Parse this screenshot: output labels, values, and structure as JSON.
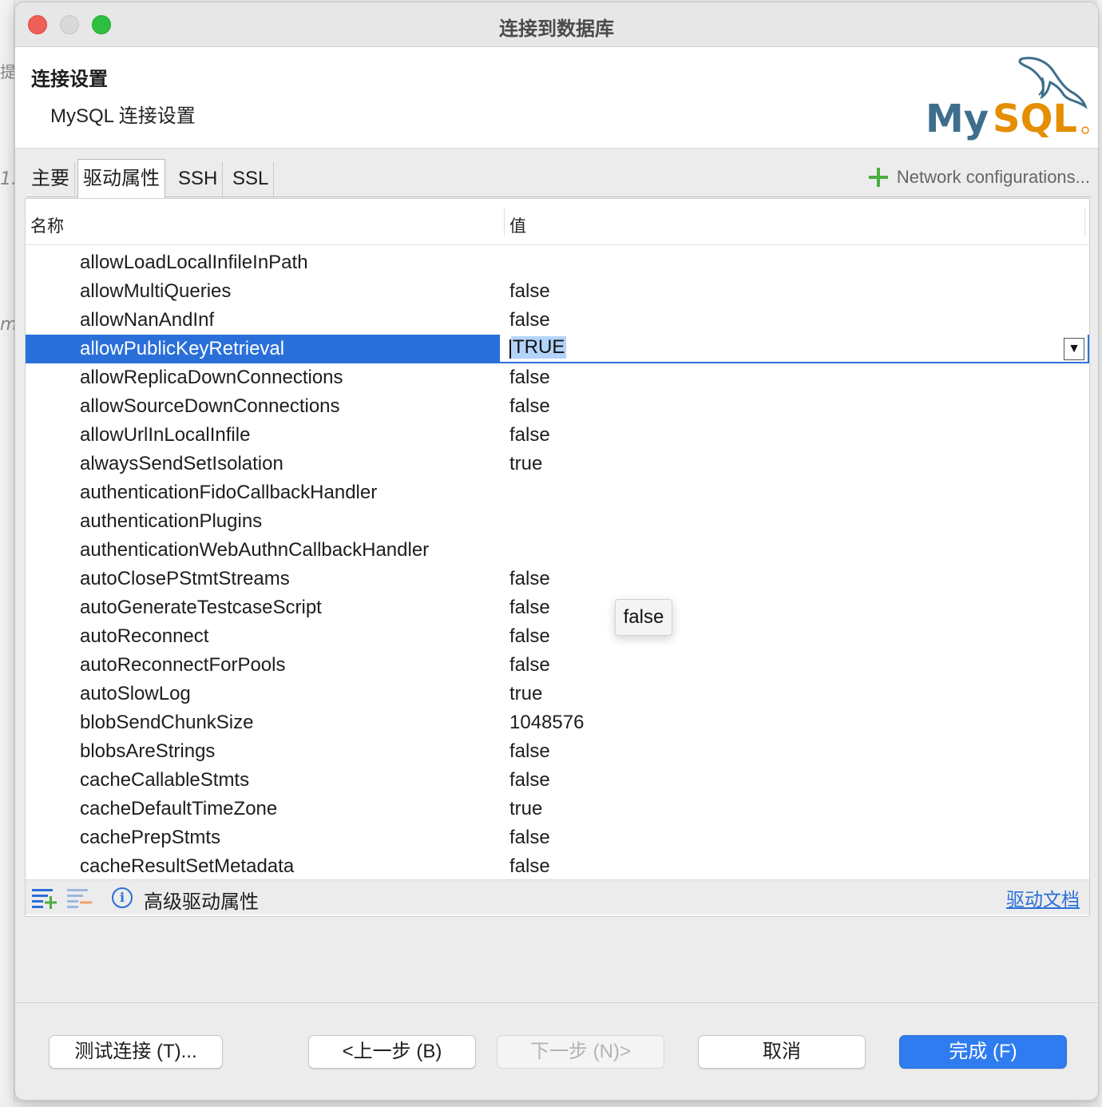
{
  "window": {
    "title": "连接到数据库"
  },
  "header": {
    "title": "连接设置",
    "subtitle": "MySQL 连接设置",
    "logo_text": "MySQL"
  },
  "tabs": [
    {
      "label": "主要",
      "active": false
    },
    {
      "label": "驱动属性",
      "active": true
    },
    {
      "label": "SSH",
      "active": false
    },
    {
      "label": "SSL",
      "active": false
    }
  ],
  "network_config": {
    "label": "Network configurations...",
    "icon": "plus-icon",
    "color": "#4bae3f"
  },
  "table": {
    "columns": [
      "名称",
      "值"
    ],
    "rows": [
      {
        "name": "allowLoadLocalInfileInPath",
        "value": ""
      },
      {
        "name": "allowMultiQueries",
        "value": "false"
      },
      {
        "name": "allowNanAndInf",
        "value": "false"
      },
      {
        "name": "allowPublicKeyRetrieval",
        "value": "TRUE",
        "selected": true
      },
      {
        "name": "allowReplicaDownConnections",
        "value": "false"
      },
      {
        "name": "allowSourceDownConnections",
        "value": "false"
      },
      {
        "name": "allowUrlInLocalInfile",
        "value": "false"
      },
      {
        "name": "alwaysSendSetIsolation",
        "value": "true"
      },
      {
        "name": "authenticationFidoCallbackHandler",
        "value": ""
      },
      {
        "name": "authenticationPlugins",
        "value": ""
      },
      {
        "name": "authenticationWebAuthnCallbackHandler",
        "value": ""
      },
      {
        "name": "autoClosePStmtStreams",
        "value": "false"
      },
      {
        "name": "autoGenerateTestcaseScript",
        "value": "false"
      },
      {
        "name": "autoReconnect",
        "value": "false"
      },
      {
        "name": "autoReconnectForPools",
        "value": "false"
      },
      {
        "name": "autoSlowLog",
        "value": "true"
      },
      {
        "name": "blobSendChunkSize",
        "value": "1048576"
      },
      {
        "name": "blobsAreStrings",
        "value": "false"
      },
      {
        "name": "cacheCallableStmts",
        "value": "false"
      },
      {
        "name": "cacheDefaultTimeZone",
        "value": "true"
      },
      {
        "name": "cachePrepStmts",
        "value": "false"
      },
      {
        "name": "cacheResultSetMetadata",
        "value": "false"
      }
    ],
    "editor": {
      "value": "TRUE",
      "dropdown_icon": "▼"
    },
    "popup_option": "false"
  },
  "table_toolbar": {
    "advanced_label": "高级驱动属性",
    "doc_link": "驱动文档"
  },
  "buttons": {
    "test": "测试连接 (T)...",
    "back": "<上一步 (B)",
    "next": "下一步 (N)>",
    "cancel": "取消",
    "finish": "完成 (F)"
  },
  "colors": {
    "accent": "#2a6fd9",
    "primary_button": "#2f7cf0",
    "mysql_blue": "#3e6e8c",
    "mysql_orange": "#e48e00"
  }
}
